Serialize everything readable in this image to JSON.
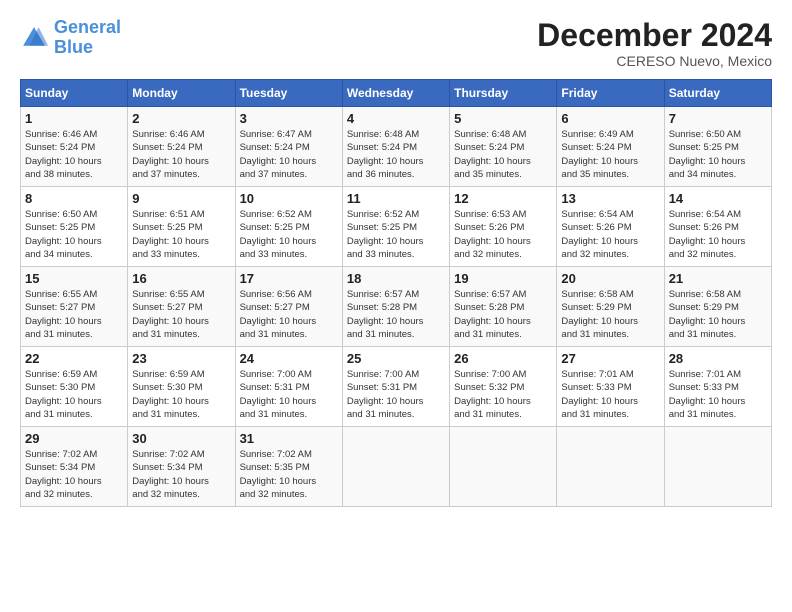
{
  "header": {
    "logo_line1": "General",
    "logo_line2": "Blue",
    "month": "December 2024",
    "location": "CERESO Nuevo, Mexico"
  },
  "days_of_week": [
    "Sunday",
    "Monday",
    "Tuesday",
    "Wednesday",
    "Thursday",
    "Friday",
    "Saturday"
  ],
  "weeks": [
    [
      {
        "day": "1",
        "info": "Sunrise: 6:46 AM\nSunset: 5:24 PM\nDaylight: 10 hours\nand 38 minutes."
      },
      {
        "day": "2",
        "info": "Sunrise: 6:46 AM\nSunset: 5:24 PM\nDaylight: 10 hours\nand 37 minutes."
      },
      {
        "day": "3",
        "info": "Sunrise: 6:47 AM\nSunset: 5:24 PM\nDaylight: 10 hours\nand 37 minutes."
      },
      {
        "day": "4",
        "info": "Sunrise: 6:48 AM\nSunset: 5:24 PM\nDaylight: 10 hours\nand 36 minutes."
      },
      {
        "day": "5",
        "info": "Sunrise: 6:48 AM\nSunset: 5:24 PM\nDaylight: 10 hours\nand 35 minutes."
      },
      {
        "day": "6",
        "info": "Sunrise: 6:49 AM\nSunset: 5:24 PM\nDaylight: 10 hours\nand 35 minutes."
      },
      {
        "day": "7",
        "info": "Sunrise: 6:50 AM\nSunset: 5:25 PM\nDaylight: 10 hours\nand 34 minutes."
      }
    ],
    [
      {
        "day": "8",
        "info": "Sunrise: 6:50 AM\nSunset: 5:25 PM\nDaylight: 10 hours\nand 34 minutes."
      },
      {
        "day": "9",
        "info": "Sunrise: 6:51 AM\nSunset: 5:25 PM\nDaylight: 10 hours\nand 33 minutes."
      },
      {
        "day": "10",
        "info": "Sunrise: 6:52 AM\nSunset: 5:25 PM\nDaylight: 10 hours\nand 33 minutes."
      },
      {
        "day": "11",
        "info": "Sunrise: 6:52 AM\nSunset: 5:25 PM\nDaylight: 10 hours\nand 33 minutes."
      },
      {
        "day": "12",
        "info": "Sunrise: 6:53 AM\nSunset: 5:26 PM\nDaylight: 10 hours\nand 32 minutes."
      },
      {
        "day": "13",
        "info": "Sunrise: 6:54 AM\nSunset: 5:26 PM\nDaylight: 10 hours\nand 32 minutes."
      },
      {
        "day": "14",
        "info": "Sunrise: 6:54 AM\nSunset: 5:26 PM\nDaylight: 10 hours\nand 32 minutes."
      }
    ],
    [
      {
        "day": "15",
        "info": "Sunrise: 6:55 AM\nSunset: 5:27 PM\nDaylight: 10 hours\nand 31 minutes."
      },
      {
        "day": "16",
        "info": "Sunrise: 6:55 AM\nSunset: 5:27 PM\nDaylight: 10 hours\nand 31 minutes."
      },
      {
        "day": "17",
        "info": "Sunrise: 6:56 AM\nSunset: 5:27 PM\nDaylight: 10 hours\nand 31 minutes."
      },
      {
        "day": "18",
        "info": "Sunrise: 6:57 AM\nSunset: 5:28 PM\nDaylight: 10 hours\nand 31 minutes."
      },
      {
        "day": "19",
        "info": "Sunrise: 6:57 AM\nSunset: 5:28 PM\nDaylight: 10 hours\nand 31 minutes."
      },
      {
        "day": "20",
        "info": "Sunrise: 6:58 AM\nSunset: 5:29 PM\nDaylight: 10 hours\nand 31 minutes."
      },
      {
        "day": "21",
        "info": "Sunrise: 6:58 AM\nSunset: 5:29 PM\nDaylight: 10 hours\nand 31 minutes."
      }
    ],
    [
      {
        "day": "22",
        "info": "Sunrise: 6:59 AM\nSunset: 5:30 PM\nDaylight: 10 hours\nand 31 minutes."
      },
      {
        "day": "23",
        "info": "Sunrise: 6:59 AM\nSunset: 5:30 PM\nDaylight: 10 hours\nand 31 minutes."
      },
      {
        "day": "24",
        "info": "Sunrise: 7:00 AM\nSunset: 5:31 PM\nDaylight: 10 hours\nand 31 minutes."
      },
      {
        "day": "25",
        "info": "Sunrise: 7:00 AM\nSunset: 5:31 PM\nDaylight: 10 hours\nand 31 minutes."
      },
      {
        "day": "26",
        "info": "Sunrise: 7:00 AM\nSunset: 5:32 PM\nDaylight: 10 hours\nand 31 minutes."
      },
      {
        "day": "27",
        "info": "Sunrise: 7:01 AM\nSunset: 5:33 PM\nDaylight: 10 hours\nand 31 minutes."
      },
      {
        "day": "28",
        "info": "Sunrise: 7:01 AM\nSunset: 5:33 PM\nDaylight: 10 hours\nand 31 minutes."
      }
    ],
    [
      {
        "day": "29",
        "info": "Sunrise: 7:02 AM\nSunset: 5:34 PM\nDaylight: 10 hours\nand 32 minutes."
      },
      {
        "day": "30",
        "info": "Sunrise: 7:02 AM\nSunset: 5:34 PM\nDaylight: 10 hours\nand 32 minutes."
      },
      {
        "day": "31",
        "info": "Sunrise: 7:02 AM\nSunset: 5:35 PM\nDaylight: 10 hours\nand 32 minutes."
      },
      {
        "day": "",
        "info": ""
      },
      {
        "day": "",
        "info": ""
      },
      {
        "day": "",
        "info": ""
      },
      {
        "day": "",
        "info": ""
      }
    ]
  ]
}
